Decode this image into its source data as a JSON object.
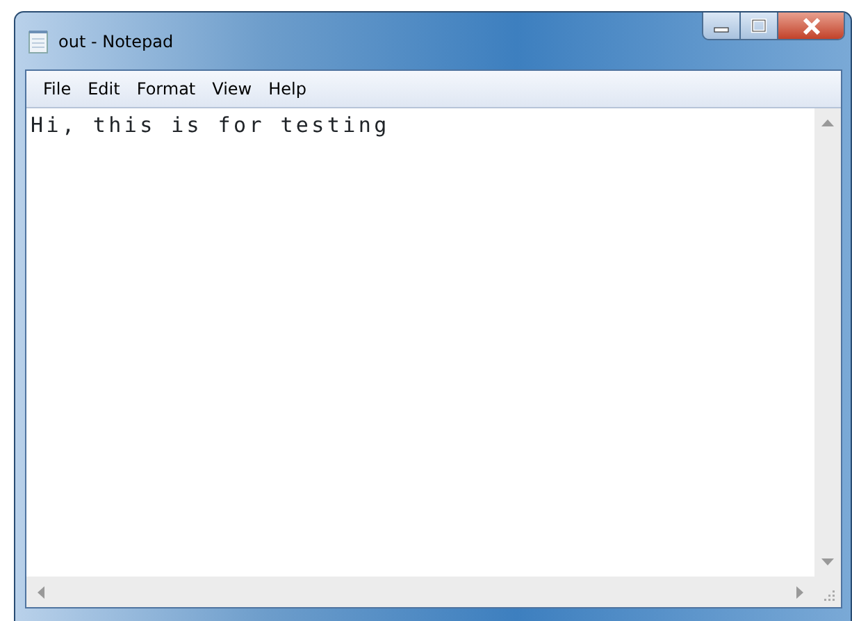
{
  "window": {
    "title": "out - Notepad"
  },
  "menu": [
    "File",
    "Edit",
    "Format",
    "View",
    "Help"
  ],
  "editor": {
    "text": "Hi, this is for testing"
  }
}
